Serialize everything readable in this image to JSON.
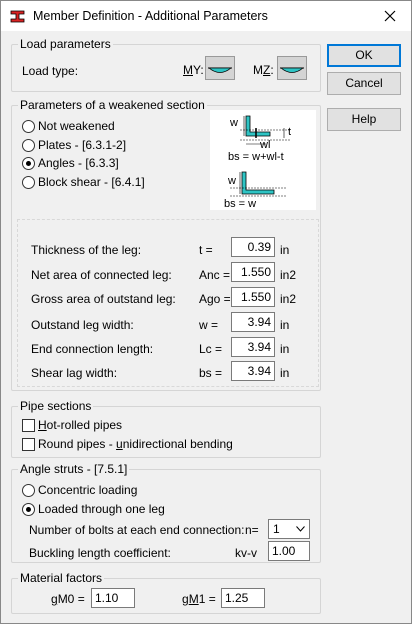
{
  "window": {
    "title": "Member Definition - Additional Parameters"
  },
  "buttons": {
    "ok": "OK",
    "cancel": "Cancel",
    "help": "Help"
  },
  "load_parameters": {
    "legend": "Load parameters",
    "load_type_label": "Load type:",
    "my_label": "MY:",
    "mz_label": "MZ:"
  },
  "weakened_section": {
    "legend": "Parameters of a weakened section",
    "options": [
      "Not weakened",
      "Plates - [6.3.1-2]",
      "Angles - [6.3.3]",
      "Block shear - [6.4.1]"
    ],
    "selected": "Angles - [6.3.3]",
    "diagram": {
      "w1": "w",
      "t_top": "t",
      "w_l": "wl",
      "bs_formula_1": "bs = w+wl-t",
      "w2": "w",
      "bs_formula_2": "bs = w"
    },
    "rows": [
      {
        "label": "Thickness of the leg:",
        "symbol": "t =",
        "value": "0.39",
        "unit": "in"
      },
      {
        "label": "Net area of connected leg:",
        "symbol": "Anc =",
        "value": "1.550",
        "unit": "in2"
      },
      {
        "label": "Gross area of outstand leg:",
        "symbol": "Ago =",
        "value": "1.550",
        "unit": "in2"
      },
      {
        "label": "Outstand leg width:",
        "symbol": "w =",
        "value": "3.94",
        "unit": "in"
      },
      {
        "label": "End connection length:",
        "symbol": "Lc =",
        "value": "3.94",
        "unit": "in"
      },
      {
        "label": "Shear lag width:",
        "symbol": "bs =",
        "value": "3.94",
        "unit": "in"
      }
    ]
  },
  "pipe_sections": {
    "legend": "Pipe sections",
    "hot_rolled": "Hot-rolled pipes",
    "round_pipes": "Round pipes - unidirectional bending"
  },
  "angle_struts": {
    "legend": "Angle struts  - [7.5.1]",
    "concentric": "Concentric loading",
    "one_leg": "Loaded through one leg",
    "selected": "Loaded through one leg",
    "bolts_label": "Number of bolts at each end connection:",
    "bolts_symbol": "n=",
    "bolts_value": "1",
    "buckling_label": "Buckling length coefficient:",
    "buckling_symbol": "kv-v",
    "buckling_value": "1.00"
  },
  "material_factors": {
    "legend": "Material factors",
    "gm0_label": "gM0 =",
    "gm0_value": "1.10",
    "gm1_label": "gM1 =",
    "gm1_value": "1.25"
  },
  "colors": {
    "accent": "#0078d7",
    "diagram_fill": "#2ec4c4",
    "icon_red": "#d92323"
  }
}
